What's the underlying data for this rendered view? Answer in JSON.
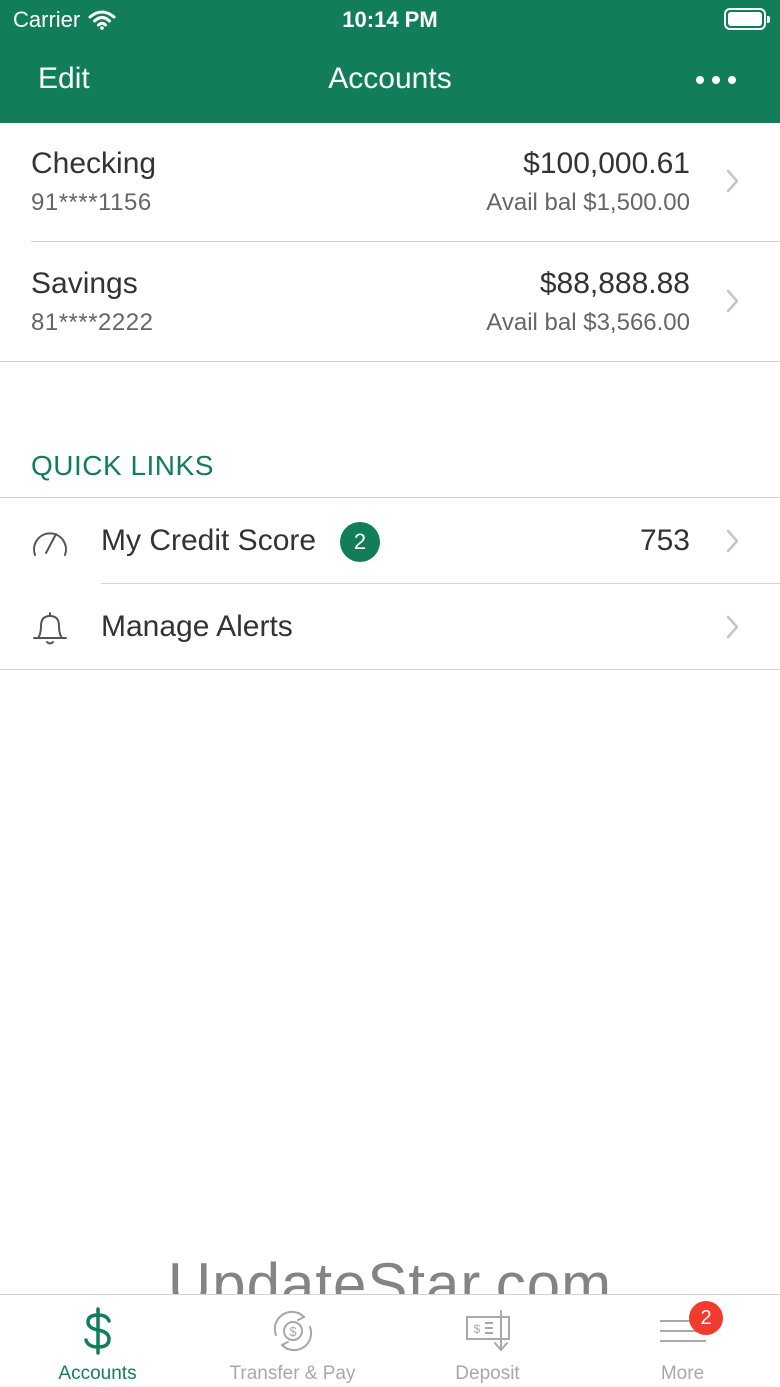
{
  "status_bar": {
    "carrier": "Carrier",
    "time": "10:14 PM"
  },
  "nav": {
    "edit_label": "Edit",
    "title": "Accounts"
  },
  "accounts": [
    {
      "name": "Checking",
      "number": "91****1156",
      "balance": "$100,000.61",
      "available": "Avail bal $1,500.00"
    },
    {
      "name": "Savings",
      "number": "81****2222",
      "balance": "$88,888.88",
      "available": "Avail bal $3,566.00"
    }
  ],
  "quick_links": {
    "heading": "QUICK LINKS",
    "items": [
      {
        "label": "My Credit Score",
        "badge": "2",
        "value": "753",
        "icon": "speedometer-icon"
      },
      {
        "label": "Manage Alerts",
        "icon": "bell-icon"
      }
    ]
  },
  "watermark": "UpdateStar.com",
  "tabs": [
    {
      "label": "Accounts",
      "icon": "dollar-icon",
      "active": true
    },
    {
      "label": "Transfer & Pay",
      "icon": "transfer-icon"
    },
    {
      "label": "Deposit",
      "icon": "check-deposit-icon"
    },
    {
      "label": "More",
      "icon": "menu-icon",
      "badge": "2"
    }
  ],
  "colors": {
    "brand": "#127e59",
    "badge_red": "#f23b2f",
    "text": "#333333",
    "muted": "#a8a8a8"
  }
}
